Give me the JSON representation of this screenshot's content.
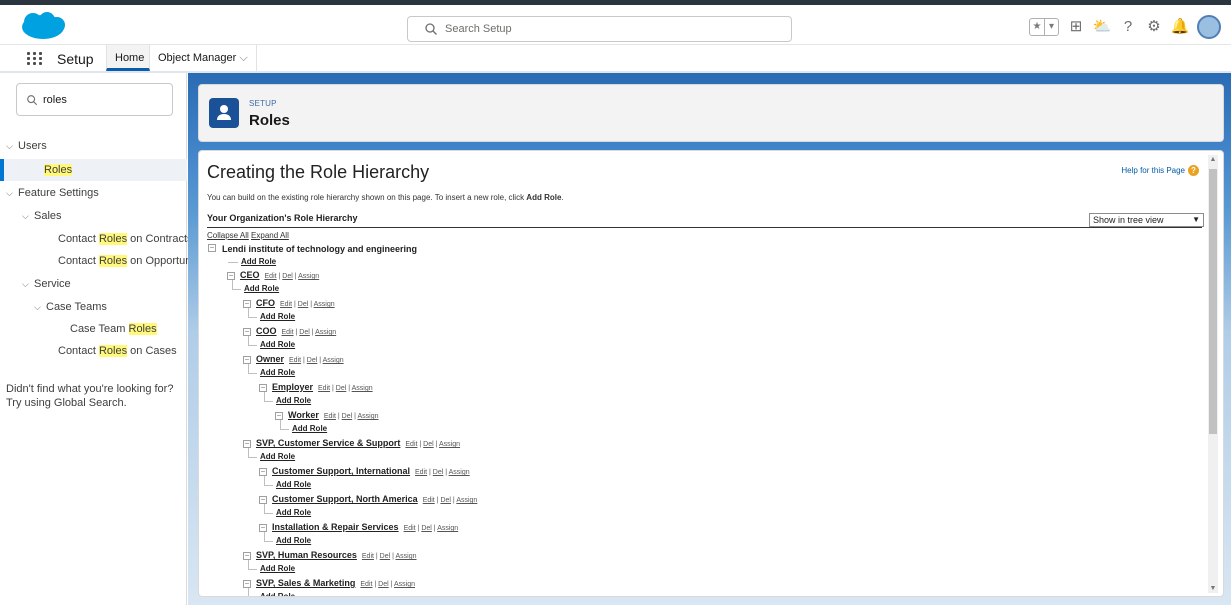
{
  "search": {
    "placeholder": "Search Setup"
  },
  "nav": {
    "app_title": "Setup",
    "tabs": [
      "Home",
      "Object Manager"
    ]
  },
  "sidebar": {
    "quick_find_value": "roles",
    "items": [
      {
        "pre": "",
        "hl": "",
        "post": "Users",
        "level": 0,
        "chevron": true
      },
      {
        "pre": "",
        "hl": "Roles",
        "post": "",
        "level": 2,
        "selected": true
      },
      {
        "pre": "",
        "hl": "",
        "post": "Feature Settings",
        "level": 0,
        "chevron": true
      },
      {
        "pre": "",
        "hl": "",
        "post": "Sales",
        "level": 1,
        "chevron": true
      },
      {
        "pre": "Contact ",
        "hl": "Roles",
        "post": " on Contracts",
        "level": 3
      },
      {
        "pre": "Contact ",
        "hl": "Roles",
        "post": " on Opportunities",
        "level": 3
      },
      {
        "pre": "",
        "hl": "",
        "post": "Service",
        "level": 1,
        "chevron": true
      },
      {
        "pre": "",
        "hl": "",
        "post": "Case Teams",
        "level": 2,
        "chevron": true
      },
      {
        "pre": "Case Team ",
        "hl": "Roles",
        "post": "",
        "level": 4
      },
      {
        "pre": "Contact ",
        "hl": "Roles",
        "post": " on Cases",
        "level": 3
      }
    ],
    "hint_line1": "Didn't find what you're looking for?",
    "hint_line2": "Try using Global Search."
  },
  "page_header": {
    "subtitle": "SETUP",
    "title": "Roles"
  },
  "content": {
    "title": "Creating the Role Hierarchy",
    "help_link": "Help for this Page",
    "intro_text": "You can build on the existing role hierarchy shown on this page. To insert a new role, click ",
    "intro_bold": "Add Role",
    "intro_end": ".",
    "org_label": "Your Organization's Role Hierarchy",
    "view_select": "Show in tree view",
    "collapse_all": "Collapse All",
    "expand_all": "Expand All",
    "root": "Lendi institute of technology and engineering",
    "add_role": "Add Role",
    "actions": {
      "edit": "Edit",
      "del": "Del",
      "assign": "Assign"
    },
    "roles": [
      {
        "name": "CEO",
        "depth": 1
      },
      {
        "name": "CFO",
        "depth": 2
      },
      {
        "name": "COO",
        "depth": 2
      },
      {
        "name": "Owner",
        "depth": 2
      },
      {
        "name": "Employer",
        "depth": 3
      },
      {
        "name": "Worker",
        "depth": 4
      },
      {
        "name": "SVP, Customer Service & Support",
        "depth": 2
      },
      {
        "name": "Customer Support, International",
        "depth": 3
      },
      {
        "name": "Customer Support, North America",
        "depth": 3
      },
      {
        "name": "Installation & Repair Services",
        "depth": 3
      },
      {
        "name": "SVP, Human Resources",
        "depth": 2
      },
      {
        "name": "SVP, Sales & Marketing",
        "depth": 2
      }
    ]
  },
  "colors": {
    "brand": "#0176d3",
    "header_icon": "#1b5297",
    "highlight": "#fff87a"
  }
}
